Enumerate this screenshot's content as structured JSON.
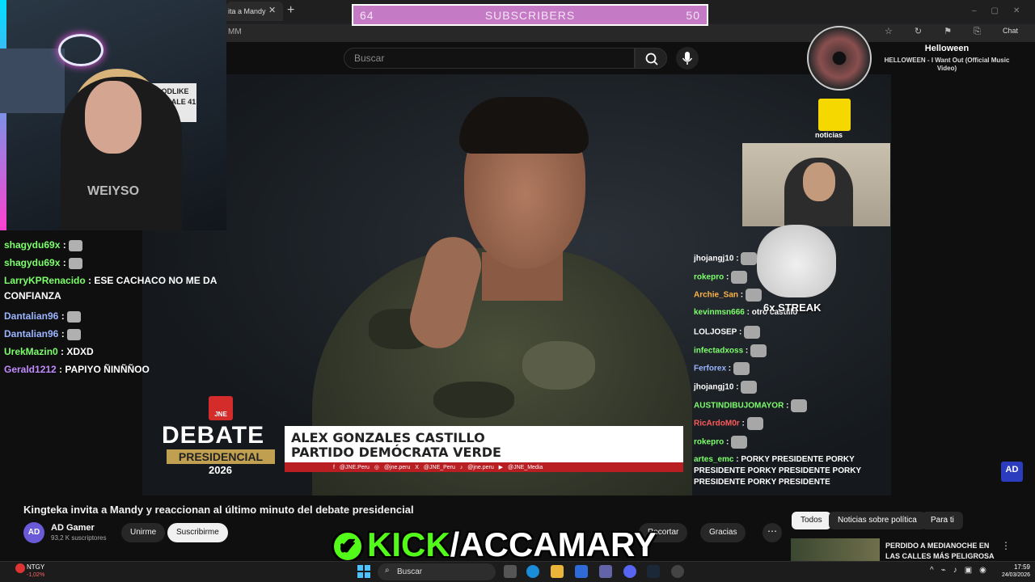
{
  "browser": {
    "tab_title": "ita a Mandy",
    "tab_close": "✕",
    "tab_new": "+",
    "address_fragment": "MM",
    "chat_link": "Chat",
    "window_controls": "–▢✕"
  },
  "subscribers_bar": {
    "left_count": "64",
    "title": "SUBSCRIBERS",
    "right_count": "50"
  },
  "youtube": {
    "search_placeholder": "Buscar",
    "video_title": "Kingteka invita a Mandy y reaccionan al último minuto del debate presidencial",
    "channel_avatar": "AD",
    "channel_name": "AD Gamer",
    "channel_subs": "93,2 K suscriptores",
    "join_label": "Unirme",
    "subscribe_label": "Suscribirme",
    "clip_label": "Recortar",
    "thanks_label": "Gracias",
    "more_label": "⋯",
    "chips": [
      "Todos",
      "Noticias sobre política",
      "Para ti"
    ],
    "recommended_title": "PERDIDO A MEDIANOCHE EN LAS CALLES MÁS PELIGROSA",
    "rec_more": "⋮"
  },
  "broadcast": {
    "jne_label": "JNE",
    "debate_title": "DEBATE",
    "debate_sub": "PRESIDENCIAL",
    "debate_year": "2026",
    "candidate_name": "ALEX GONZALES CASTILLO",
    "candidate_party": "PARTIDO DEMÓCRATA VERDE",
    "social_strip": "f @JNE.Peru  ◎ @jne.peru  X @JNE_Peru  ♪ @jne.peru  ▶ @JNE_Media",
    "channel_bug": "AD"
  },
  "webcam": {
    "sign_text": "GODLIKE VALIE ALE 41",
    "shirt_text": "WEIYSO"
  },
  "left_chat": [
    {
      "user": "shagydu69x",
      "color": "#7cff6b",
      "message": "",
      "emote": true
    },
    {
      "user": "shagydu69x",
      "color": "#7cff6b",
      "message": "",
      "emote": true
    },
    {
      "user": "LarryKPRenacido",
      "color": "#7cff6b",
      "message": "ESE CACHACO NO ME DA CONFIANZA",
      "emote": false
    },
    {
      "user": "Dantalian96",
      "color": "#9ab4ff",
      "message": "",
      "emote": true
    },
    {
      "user": "Dantalian96",
      "color": "#9ab4ff",
      "message": "",
      "emote": true
    },
    {
      "user": "UrekMazin0",
      "color": "#7cff6b",
      "message": "XDXD",
      "emote": false
    },
    {
      "user": "Gerald1212",
      "color": "#c18cff",
      "message": "PAPIYO ÑINÑÑOO",
      "emote": false
    }
  ],
  "right_chat": [
    {
      "user": "jhojangj10",
      "color": "#ffffff",
      "message": "",
      "emote": true
    },
    {
      "user": "rokepro",
      "color": "#7cff6b",
      "message": "",
      "emote": true
    },
    {
      "user": "Archie_San",
      "color": "#ffb347",
      "message": "",
      "emote": true
    },
    {
      "user": "kevinmsn666",
      "color": "#7cff6b",
      "message": "otro castillo",
      "emote": false
    },
    {
      "user": "LOLJOSEP",
      "color": "#ffffff",
      "message": "",
      "emote": true
    },
    {
      "user": "infectadxoss",
      "color": "#7cff6b",
      "message": "",
      "emote": true
    },
    {
      "user": "Ferforex",
      "color": "#9ab4ff",
      "message": "",
      "emote": true
    },
    {
      "user": "jhojangj10",
      "color": "#ffffff",
      "message": "",
      "emote": true
    },
    {
      "user": "AUSTINDIBUJOMAYOR",
      "color": "#7cff6b",
      "message": "",
      "emote": true
    },
    {
      "user": "RicArdoM0r",
      "color": "#ff5a5a",
      "message": "",
      "emote": true
    },
    {
      "user": "rokepro",
      "color": "#7cff6b",
      "message": "",
      "emote": true
    },
    {
      "user": "artes_emc",
      "color": "#7cff6b",
      "message": "PORKY PRESIDENTE PORKY PRESIDENTE PORKY PRESIDENTE PORKY PRESIDENTE PORKY PRESIDENTE",
      "emote": false
    }
  ],
  "streak": {
    "label": "6x STREAK"
  },
  "reaction_cam": {
    "logo_label": "noticias"
  },
  "now_playing": {
    "title": "Helloween",
    "track": "HELLOWEEN - I Want Out (Official Music Video)"
  },
  "kick": {
    "check": "✔",
    "green_part": "KICK",
    "white_part": "/ACCAMARY"
  },
  "taskbar": {
    "stock_name": "NTGY",
    "stock_change": "-1,02%",
    "search_label": "Buscar",
    "tray_icons": "^⌁♪▣◉",
    "time": "17:59",
    "date": "24/03/2026"
  },
  "colors": {
    "subscribers_bar": "#c47ac4",
    "kick_green": "#53fc18",
    "news_red": "#b91e23",
    "noticias_yellow": "#f5d800"
  }
}
